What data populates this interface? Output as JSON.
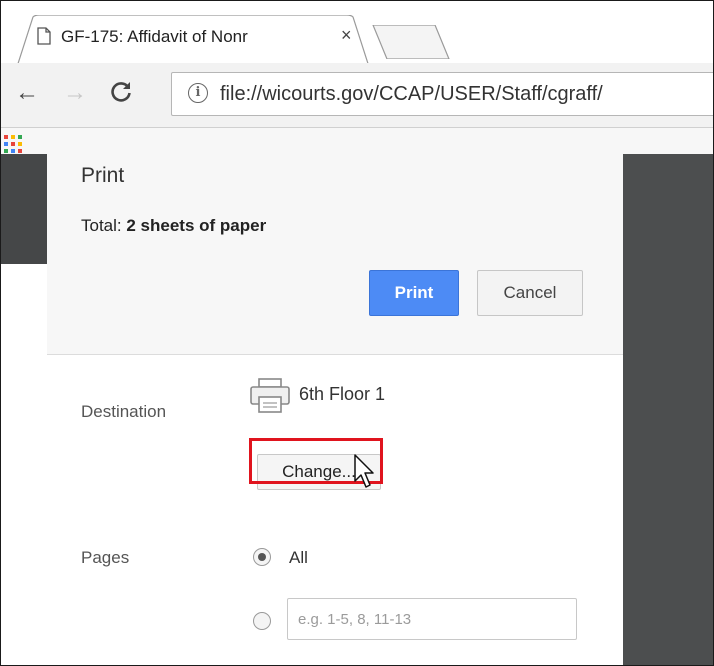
{
  "browser": {
    "tab": {
      "title": "GF-175: Affidavit of Nonr",
      "close_glyph": "×",
      "icon": "page-icon"
    },
    "nav": {
      "back_glyph": "←",
      "forward_glyph": "→",
      "reload_icon": "reload-icon"
    },
    "address": {
      "info_glyph": "i",
      "url": "file://wicourts.gov/CCAP/USER/Staff/cgraff/"
    }
  },
  "print_dialog": {
    "title": "Print",
    "total_label": "Total:",
    "total_value": "2 sheets of paper",
    "print_button": "Print",
    "cancel_button": "Cancel",
    "destination": {
      "label": "Destination",
      "printer_name": "6th Floor 1",
      "change_button": "Change..."
    },
    "pages": {
      "label": "Pages",
      "all_label": "All",
      "selected": "All",
      "range_placeholder": "e.g. 1-5, 8, 11-13",
      "range_value": ""
    }
  },
  "colors": {
    "print_button": "#4d8bf5",
    "highlight_border": "#e0141e"
  }
}
